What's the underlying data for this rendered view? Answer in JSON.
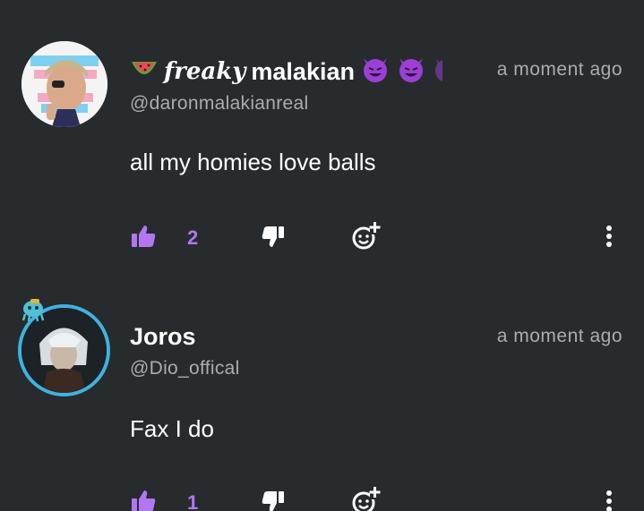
{
  "comments": [
    {
      "display_name_fancy": "freaky",
      "display_name": "malakian",
      "handle": "@daronmalakianreal",
      "timestamp": "a moment ago",
      "text": "all my homies love balls",
      "likes": "2",
      "badge_icons": [
        "watermelon-icon",
        "devil-emoji-icon",
        "devil-emoji-icon",
        "devil-emoji-icon"
      ]
    },
    {
      "display_name": "Joros",
      "handle": "@Dio_offical",
      "timestamp": "a moment ago",
      "text": "Fax I do",
      "likes": "1",
      "avatar_ring_color": "#3fb2e0"
    }
  ],
  "colors": {
    "background": "#272b2d",
    "accent": "#b277f0",
    "muted": "#a9adb0",
    "text": "#ffffff"
  }
}
